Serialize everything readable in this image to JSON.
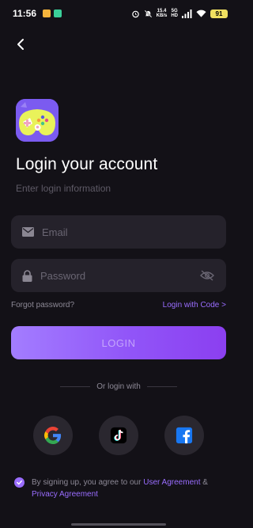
{
  "status_bar": {
    "time": "11:56",
    "speed_value": "15.4",
    "speed_unit": "KB/s",
    "network_top": "5G",
    "network_bottom": "HD",
    "battery": "91"
  },
  "login": {
    "title": "Login your account",
    "subtitle": "Enter login information",
    "email_placeholder": "Email",
    "password_placeholder": "Password",
    "forgot_password": "Forgot password?",
    "login_with_code": "Login with Code >",
    "login_button": "LOGIN",
    "or_login_with": "Or login with"
  },
  "agreement": {
    "prefix": "By signing up, you agree to our",
    "user_agreement": "User Agreement",
    "ampersand": "&",
    "privacy_agreement": "Privacy Agreement"
  },
  "colors": {
    "background": "#131117",
    "accent": "#9a6dff",
    "field_bg": "#25222b"
  },
  "icons": {
    "back": "chevron-left-icon",
    "email": "envelope-icon",
    "password": "lock-icon",
    "visibility": "eye-off-icon",
    "google": "google-icon",
    "tiktok": "tiktok-icon",
    "facebook": "facebook-icon"
  }
}
